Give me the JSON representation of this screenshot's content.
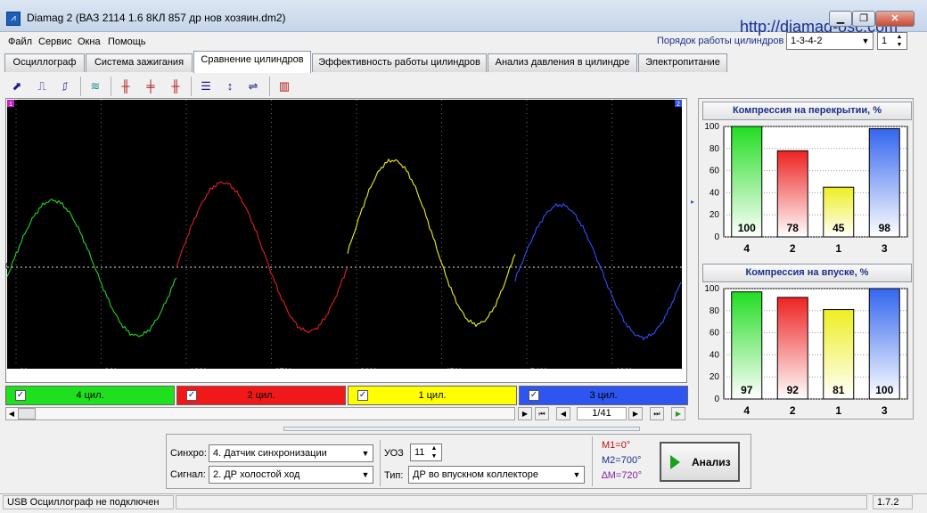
{
  "window": {
    "title": "Diamag 2 (ВАЗ 2114 1.6 8КЛ 857 др нов хозяин.dm2)",
    "url_overlay": "http://diamag-osc.com"
  },
  "menu": [
    "Файл",
    "Сервис",
    "Окна",
    "Помощь"
  ],
  "cylinder_order": {
    "label": "Порядок работы цилиндров",
    "value": "1-3-4-2",
    "spinner_value": "1"
  },
  "tabs": [
    {
      "label": "Осциллограф",
      "active": false
    },
    {
      "label": "Система зажигания",
      "active": false
    },
    {
      "label": "Сравнение цилиндров",
      "active": true
    },
    {
      "label": "Эффективность работы цилиндров",
      "active": false
    },
    {
      "label": "Анализ давления в цилиндре",
      "active": false
    },
    {
      "label": "Электропитание",
      "active": false
    }
  ],
  "toolbar_icons": [
    "cursor-tool-icon",
    "rising-edge-icon",
    "falling-edge-icon",
    "signal-icon",
    "marker-left-icon",
    "marker-mid-icon",
    "marker-right-icon",
    "hlines-icon",
    "vscale-icon",
    "hscale-icon",
    "bar-chart-icon"
  ],
  "scope": {
    "zero_label": "0",
    "marker_left": "1",
    "marker_right": "2",
    "x_ticks": [
      "0°",
      "90°",
      "180°",
      "270°",
      "360°",
      "450°",
      "540°",
      "630°"
    ],
    "x_tick_values": [
      0,
      90,
      180,
      270,
      360,
      450,
      540,
      630
    ],
    "x_range": [
      0,
      720
    ],
    "trace_colors": [
      "#22d822",
      "#e02020",
      "#f0f020",
      "#3050ff"
    ]
  },
  "lanes": [
    {
      "label": "4 цил.",
      "color": "#1ee01e",
      "checked": true
    },
    {
      "label": "2 цил.",
      "color": "#f01818",
      "checked": true
    },
    {
      "label": "1 цил.",
      "color": "#ffff00",
      "checked": true
    },
    {
      "label": "3 цил.",
      "color": "#2e55f0",
      "checked": true
    }
  ],
  "navigation": {
    "page": "1/41"
  },
  "chart_data": [
    {
      "type": "bar",
      "title": "Компрессия на перекрытии, %",
      "categories": [
        "4",
        "2",
        "1",
        "3"
      ],
      "values": [
        100,
        78,
        45,
        98
      ],
      "ylim": [
        0,
        100
      ],
      "yticks": [
        0,
        20,
        40,
        60,
        80,
        100
      ],
      "colors": [
        "#22dd22",
        "#ee2222",
        "#eeee22",
        "#3366ee"
      ]
    },
    {
      "type": "bar",
      "title": "Компрессия на впуске, %",
      "categories": [
        "4",
        "2",
        "1",
        "3"
      ],
      "values": [
        97,
        92,
        81,
        100
      ],
      "ylim": [
        0,
        100
      ],
      "yticks": [
        0,
        20,
        40,
        60,
        80,
        100
      ],
      "colors": [
        "#22dd22",
        "#ee2222",
        "#eeee22",
        "#3366ee"
      ]
    }
  ],
  "bottom": {
    "sync_label": "Синхро:",
    "sync_value": "4.  Датчик синхронизации",
    "signal_label": "Сигнал:",
    "signal_value": "2.  ДР холостой ход",
    "uoz_label": "УОЗ",
    "uoz_value": "11",
    "type_label": "Тип:",
    "type_value": "ДР во впускном коллекторе",
    "m1": "M1=0°",
    "m2": "M2=700°",
    "dm": "∆M=720°",
    "analyze": "Анализ"
  },
  "status": {
    "connection": "USB Осциллограф не подключен",
    "version": "1.7.2"
  }
}
